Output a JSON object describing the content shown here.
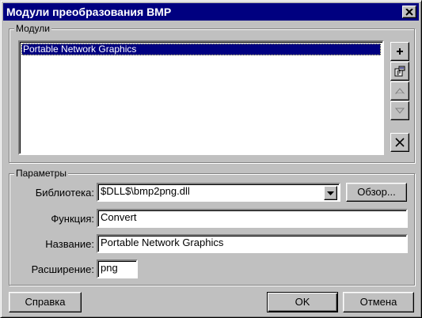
{
  "window": {
    "title": "Модули преобразования BMP",
    "close_icon": "close-icon"
  },
  "modules": {
    "legend": "Модули",
    "items": [
      {
        "label": "Portable Network Graphics",
        "selected": true
      }
    ],
    "toolbar": [
      {
        "name": "add-module-button",
        "icon": "plus-icon",
        "enabled": true
      },
      {
        "name": "edit-module-button",
        "icon": "properties-icon",
        "enabled": true
      },
      {
        "name": "move-up-button",
        "icon": "triangle-up-icon",
        "enabled": false
      },
      {
        "name": "move-down-button",
        "icon": "triangle-down-icon",
        "enabled": false
      },
      {
        "name": "delete-module-button",
        "icon": "cross-icon",
        "enabled": true
      }
    ]
  },
  "params": {
    "legend": "Параметры",
    "library_label": "Библиотека:",
    "library_value": "$DLL$\\bmp2png.dll",
    "browse_label": "Обзор...",
    "function_label": "Функция:",
    "function_value": "Convert",
    "name_label": "Название:",
    "name_value": "Portable Network Graphics",
    "ext_label": "Расширение:",
    "ext_value": "png"
  },
  "footer": {
    "help_label": "Справка",
    "ok_label": "OK",
    "cancel_label": "Отмена"
  },
  "colors": {
    "face": "#c0c0c0",
    "titlebar": "#000080",
    "selection": "#000080"
  }
}
